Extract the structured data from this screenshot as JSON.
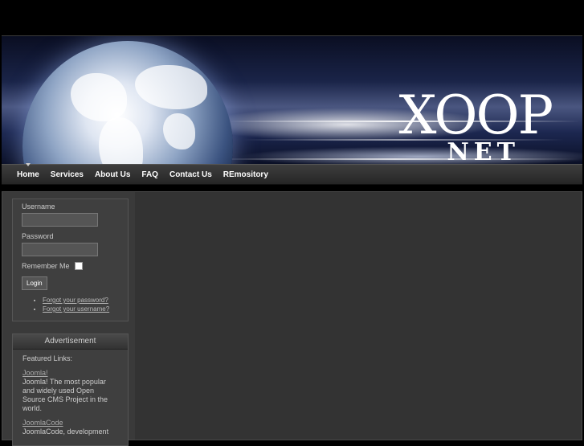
{
  "header": {
    "logo_main": "XOOP",
    "logo_sub": "NET"
  },
  "nav": {
    "items": [
      {
        "label": "Home",
        "active": true
      },
      {
        "label": "Services"
      },
      {
        "label": "About Us"
      },
      {
        "label": "FAQ"
      },
      {
        "label": "Contact Us"
      },
      {
        "label": "REmository"
      }
    ]
  },
  "login": {
    "username_label": "Username",
    "username_value": "",
    "password_label": "Password",
    "password_value": "",
    "remember_label": "Remember Me",
    "login_button": "Login",
    "forgot_password": "Forgot your password?",
    "forgot_username": "Forgot your username?"
  },
  "advertisement": {
    "title": "Advertisement",
    "featured_label": "Featured Links:",
    "links": [
      {
        "title": "Joomla!",
        "description": "Joomla! The most popular and widely used Open Source CMS Project in the world."
      },
      {
        "title": "JoomlaCode",
        "description": "JoomlaCode, development"
      }
    ]
  }
}
